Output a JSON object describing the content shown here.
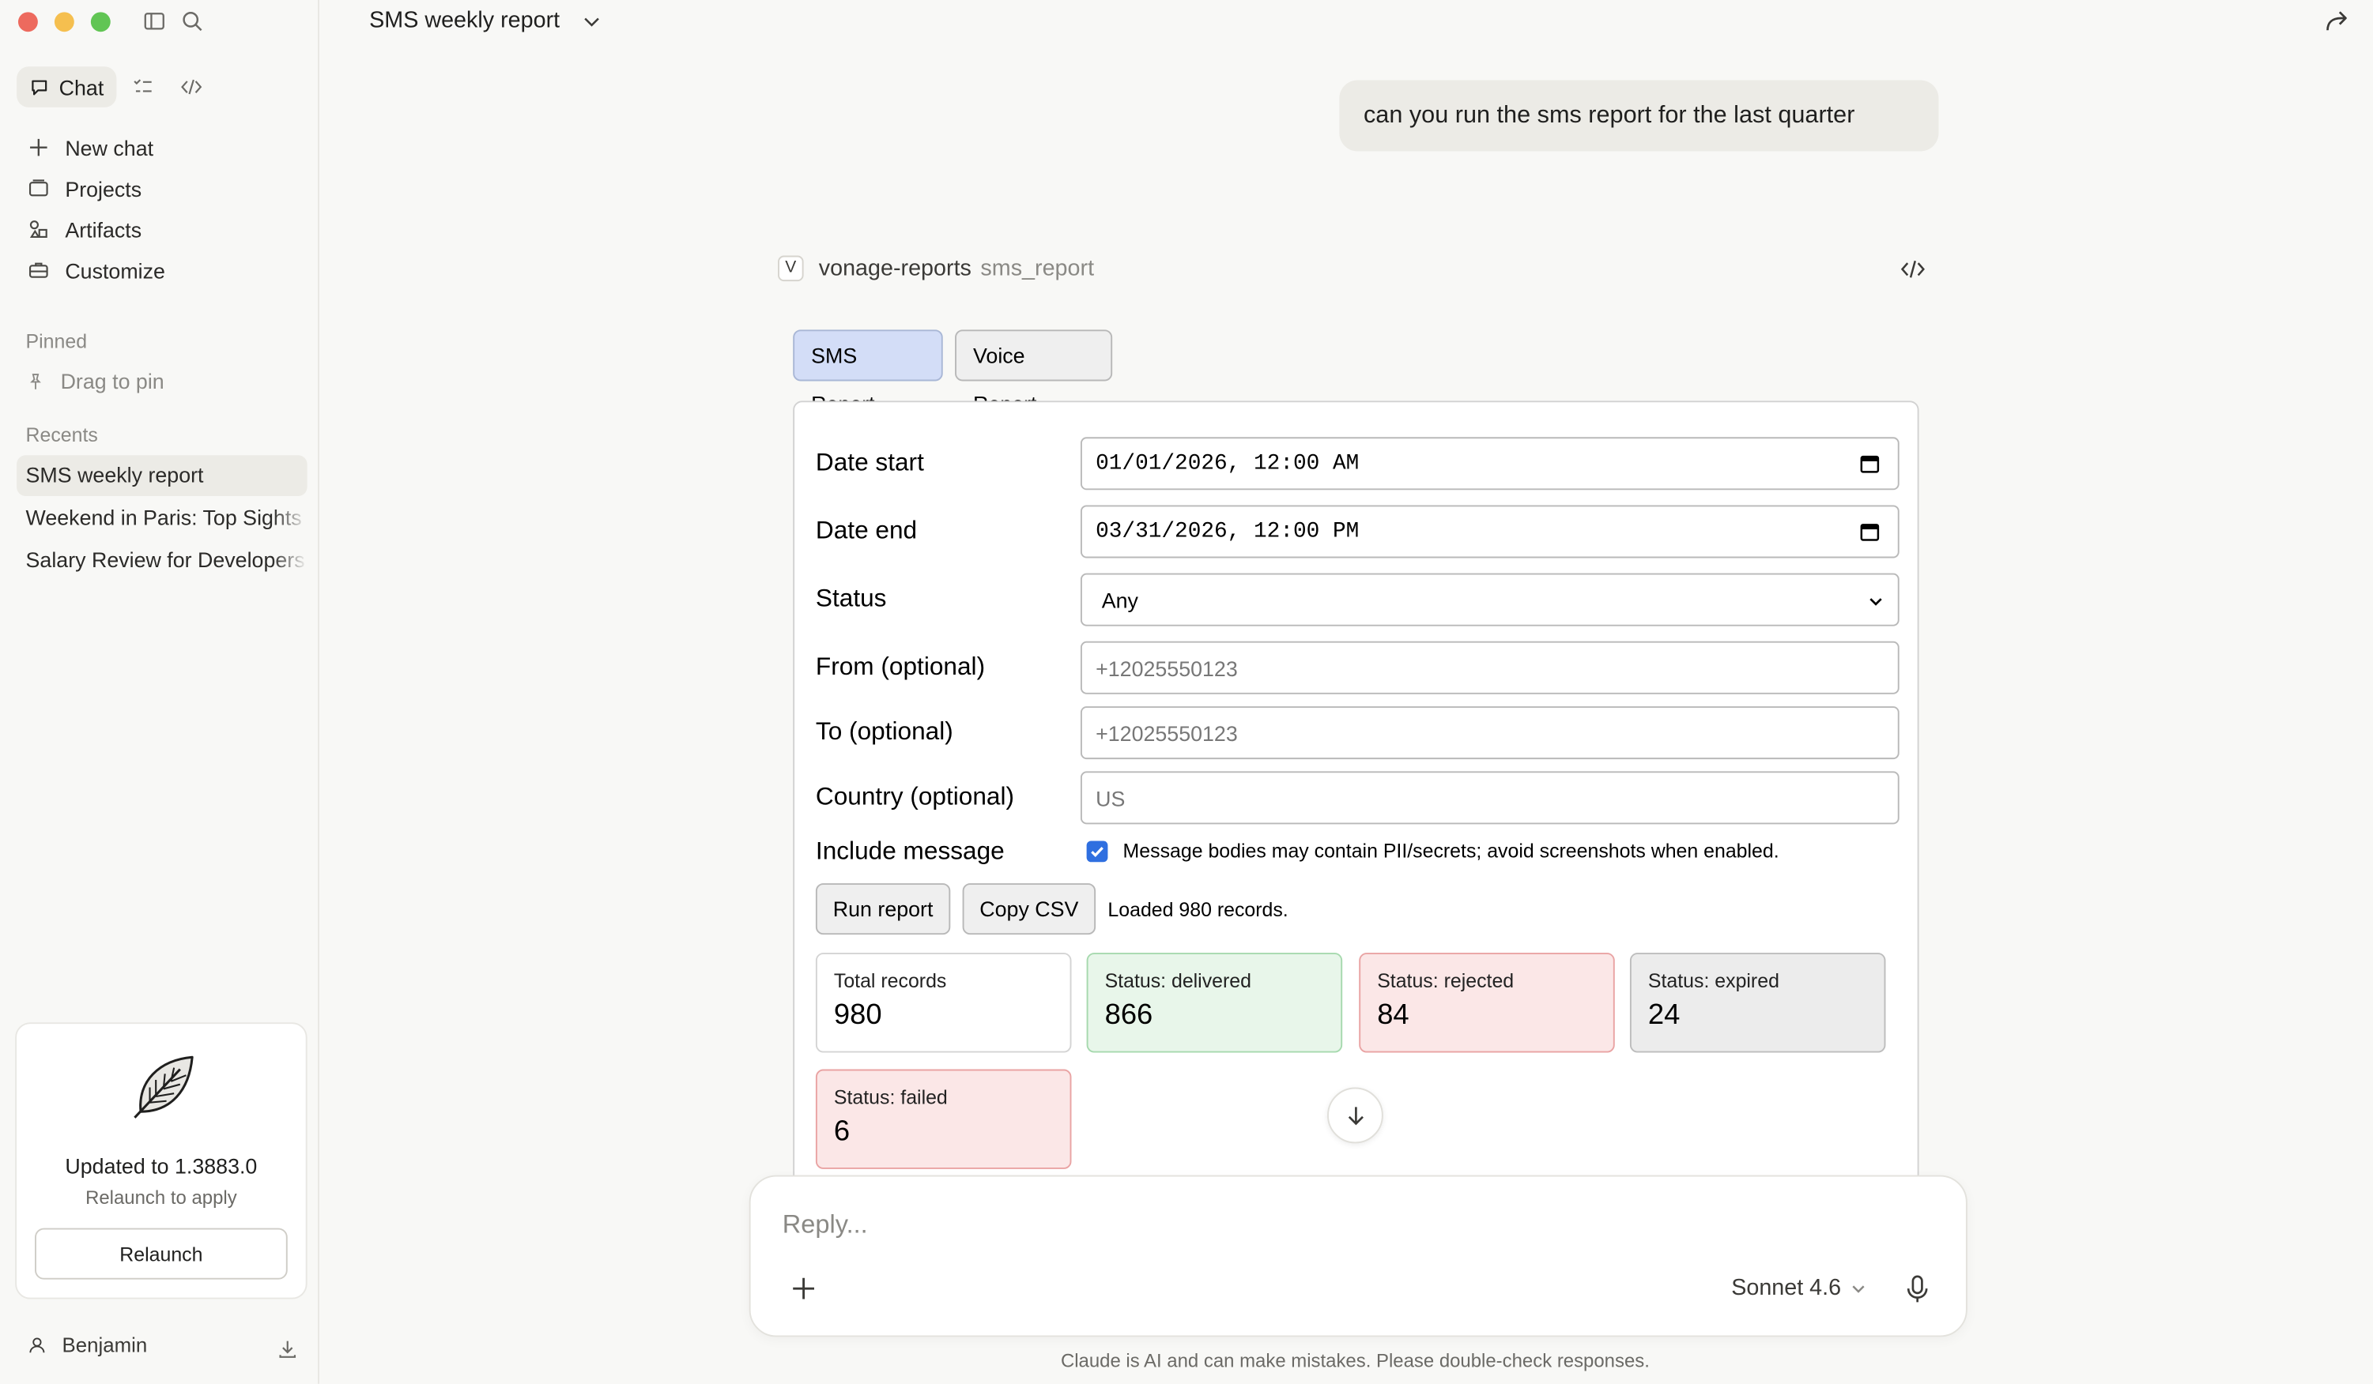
{
  "sidebar": {
    "mode_chat": "Chat",
    "nav": [
      "New chat",
      "Projects",
      "Artifacts",
      "Customize"
    ],
    "pinned_label": "Pinned",
    "pin_hint": "Drag to pin",
    "recents_label": "Recents",
    "recents": [
      "SMS weekly report",
      "Weekend in Paris: Top Sights",
      "Salary Review for Developers"
    ],
    "update": {
      "title": "Updated to 1.3883.0",
      "subtitle": "Relaunch to apply",
      "button": "Relaunch"
    },
    "user": "Benjamin"
  },
  "header": {
    "title": "SMS weekly report"
  },
  "message": {
    "user": "can you run the sms report for the last quarter"
  },
  "tool": {
    "badge": "V",
    "server": "vonage-reports",
    "function": "sms_report"
  },
  "report": {
    "tabs": [
      "SMS Report",
      "Voice Report"
    ],
    "labels": {
      "date_start": "Date start",
      "date_end": "Date end",
      "status": "Status",
      "from": "From (optional)",
      "to": "To (optional)",
      "country": "Country (optional)",
      "include_message": "Include message"
    },
    "values": {
      "date_start": "01/01/2026, 12:00 AM",
      "date_end": "03/31/2026, 12:00 PM",
      "status": "Any"
    },
    "placeholders": {
      "from": "+12025550123",
      "to": "+12025550123",
      "country": "US"
    },
    "include_message_checked": true,
    "include_message_note": "Message bodies may contain PII/secrets; avoid screenshots when enabled.",
    "buttons": {
      "run": "Run report",
      "copy": "Copy CSV"
    },
    "loaded_text": "Loaded 980 records.",
    "stats": [
      {
        "label": "Total records",
        "value": "980"
      },
      {
        "label": "Status: delivered",
        "value": "866"
      },
      {
        "label": "Status: rejected",
        "value": "84"
      },
      {
        "label": "Status: expired",
        "value": "24"
      },
      {
        "label": "Status: failed",
        "value": "6"
      }
    ]
  },
  "composer": {
    "placeholder": "Reply...",
    "model": "Sonnet 4.6"
  },
  "footer": {
    "disclaimer": "Claude is AI and can make mistakes. Please double-check responses."
  },
  "colors": {
    "accent_checkbox": "#2f6fe0",
    "tab_active": "#d3ddf7",
    "delivered_bg": "#e8f6ea",
    "rejected_bg": "#fbe7e7",
    "expired_bg": "#ececec"
  }
}
